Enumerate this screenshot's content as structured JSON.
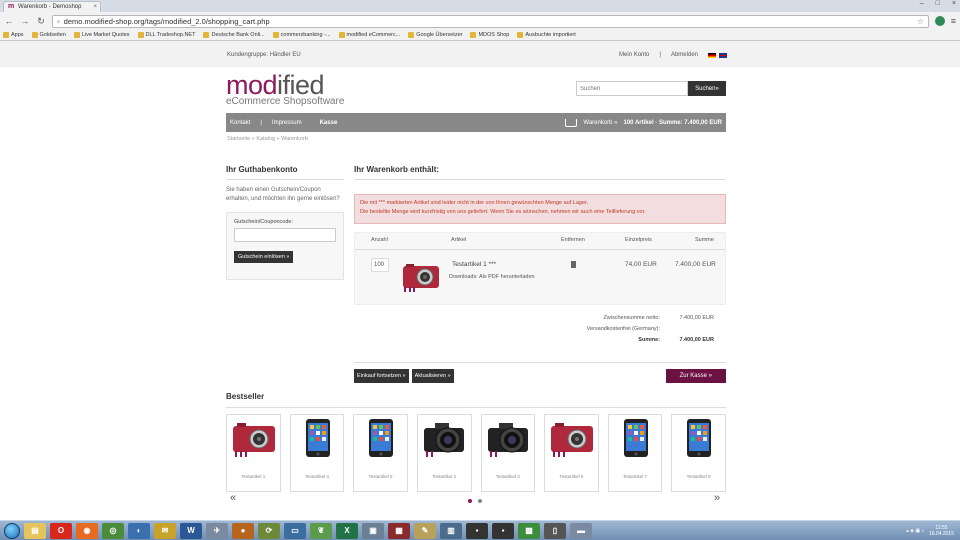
{
  "browser": {
    "tab_title": "Warenkorb - Demoshop",
    "url": "demo.modified-shop.org/tags/modified_2.0/shopping_cart.php",
    "bookmarks": [
      "Apps",
      "Goldseiten",
      "Live Market Quotes",
      "DLL Tradeshop.NET",
      "Deutsche Bank Onli...",
      "commerzbanking -...",
      "modified eCommerc...",
      "Google Übersetzer",
      "MDOS Shop",
      "Ausbuchte importiert"
    ]
  },
  "topbar": {
    "customer_group": "Kundengruppe: Händler EU",
    "my_account": "Mein Konto",
    "sep": "|",
    "logout": "Abmelden"
  },
  "logo": {
    "part1": "mod",
    "part2": "ified",
    "tagline": "eCommerce Shopsoftware"
  },
  "search": {
    "placeholder": "Suchen",
    "button": "Suchen»"
  },
  "nav": {
    "items": [
      "Kontakt",
      "Impressum",
      "Kasse"
    ],
    "sep": "|",
    "cart_link": "Warenkorb »",
    "cart_summary": "100 Artikel · Summe: 7.400,00 EUR"
  },
  "breadcrumb": "Startseite » Katalog » Warenkorb",
  "voucher": {
    "title": "Ihr Guthabenkonto",
    "text": "Sie haben einen Gutschein/Coupon erhalten, und möchten ihn gerne einlösen?",
    "label": "Gutschein/Couponcode:",
    "button": "Gutschein einlösen »"
  },
  "cart": {
    "title": "Ihr Warenkorb enthält:",
    "alert_line1": "Die mit *** markierten Artikel sind leider nicht in der von Ihnen gewünschten Menge auf Lager.",
    "alert_line2": "Die bestellte Menge wird kurzfristig von uns geliefert. Wenn Sie es wünschen, nehmen wir auch eine Teillieferung vor.",
    "headers": {
      "qty": "Anzahl",
      "article": "Artikel",
      "remove": "Entfernen",
      "unit": "Einzelpreis",
      "sum": "Summe"
    },
    "item": {
      "qty": "100",
      "name": "Testartikel 1 ***",
      "downloads": "Downloads: Als PDF herunterladen",
      "unit_price": "74,00 EUR",
      "total": "7.400,00 EUR"
    },
    "subtotal_label": "Zwischensumme netto:",
    "subtotal": "7.400,00 EUR",
    "shipping_label": "Versandkostenfrei (Germany):",
    "shipping": "",
    "total_label": "Summe:",
    "total": "7.400,00 EUR",
    "btn_continue": "Einkauf fortsetzen »",
    "btn_update": "Aktualisieren »",
    "btn_checkout": "Zur Kasse »"
  },
  "bestseller": {
    "title": "Bestseller",
    "items": [
      {
        "type": "camera",
        "name": "Testartikel 1"
      },
      {
        "type": "phone",
        "name": "Testartikel 4"
      },
      {
        "type": "phone",
        "name": "Testartikel 5"
      },
      {
        "type": "dslr",
        "name": "Testartikel 2"
      },
      {
        "type": "dslr",
        "name": "Testartikel 3"
      },
      {
        "type": "camera",
        "name": "Testartikel 6"
      },
      {
        "type": "phone",
        "name": "Testartikel 7"
      },
      {
        "type": "phone",
        "name": "Testartikel 8"
      }
    ],
    "prev": "«",
    "next": "»"
  },
  "taskbar": {
    "time": "11:55",
    "date": "16.04.2015"
  },
  "colors": {
    "brand": "#8b1a5c",
    "checkout": "#6b1243",
    "nav": "#888888",
    "alert_bg": "#f2dede"
  }
}
